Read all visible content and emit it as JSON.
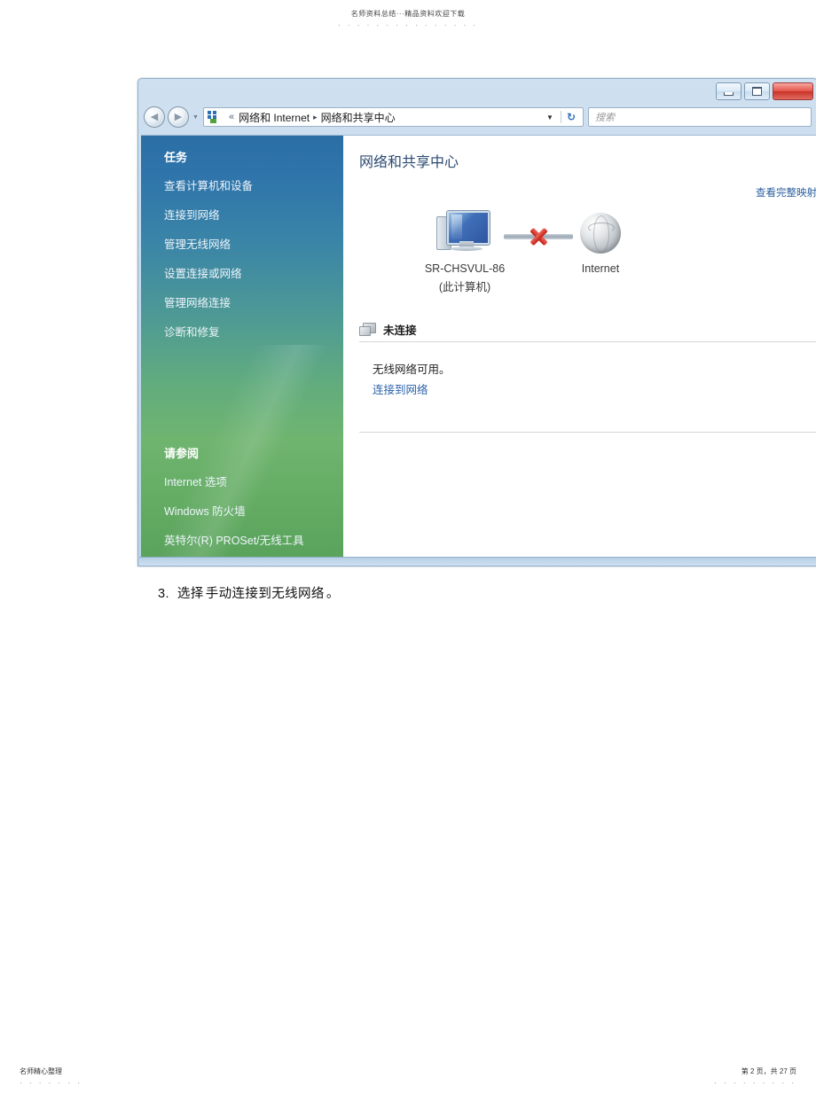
{
  "document": {
    "header_text": "名师资料总结···精品资料欢迎下载",
    "header_dots": "· · · · · · · · · · · · · · ·",
    "footer_left": "名师精心整理",
    "footer_left_dots": "· · · · · · ·",
    "footer_right": "第 2 页，共 27 页",
    "footer_right_dots": "· · · · · · · · ·",
    "instruction": {
      "number": "3.",
      "verb": "选择",
      "target": "手动连接到无线网络",
      "period": "。"
    }
  },
  "window": {
    "controls": {
      "minimize": "最小化",
      "maximize": "最大化",
      "close": "关闭"
    },
    "nav": {
      "back": "后退",
      "forward": "前进",
      "recent_pages": "最近的页面",
      "breadcrumb_prefix": "«",
      "breadcrumb": [
        "网络和 Internet",
        "网络和共享中心"
      ],
      "breadcrumb_separator": "▸",
      "address_dropdown": "▼",
      "refresh": "↻"
    },
    "search": {
      "placeholder": "搜索",
      "value": ""
    }
  },
  "sidebar": {
    "tasks_heading": "任务",
    "tasks": [
      {
        "label": "查看计算机和设备"
      },
      {
        "label": "连接到网络"
      },
      {
        "label": "管理无线网络"
      },
      {
        "label": "设置连接或网络"
      },
      {
        "label": "管理网络连接"
      },
      {
        "label": "诊断和修复"
      }
    ],
    "see_also_heading": "请参阅",
    "see_also": [
      {
        "label": "Internet 选项"
      },
      {
        "label": "Windows 防火墙"
      },
      {
        "label": "英特尔(R) PROSet/无线工具"
      }
    ]
  },
  "content": {
    "title": "网络和共享中心",
    "full_map_link": "查看完整映射",
    "map": {
      "computer_name": "SR-CHSVUL-86",
      "computer_sub": "(此计算机)",
      "internet_label": "Internet",
      "connection_state": "broken"
    },
    "status": {
      "label": "未连接"
    },
    "available": {
      "message": "无线网络可用。",
      "link": "连接到网络"
    }
  },
  "colors": {
    "sidebar_top": "#2b6ea6",
    "sidebar_bottom": "#5aa35c",
    "titlebar": "#c2d8ec",
    "heading_blue": "#2c4a72",
    "link_blue": "#2b62a8",
    "error_red": "#c01f15",
    "close_button_red": "#c93429"
  }
}
